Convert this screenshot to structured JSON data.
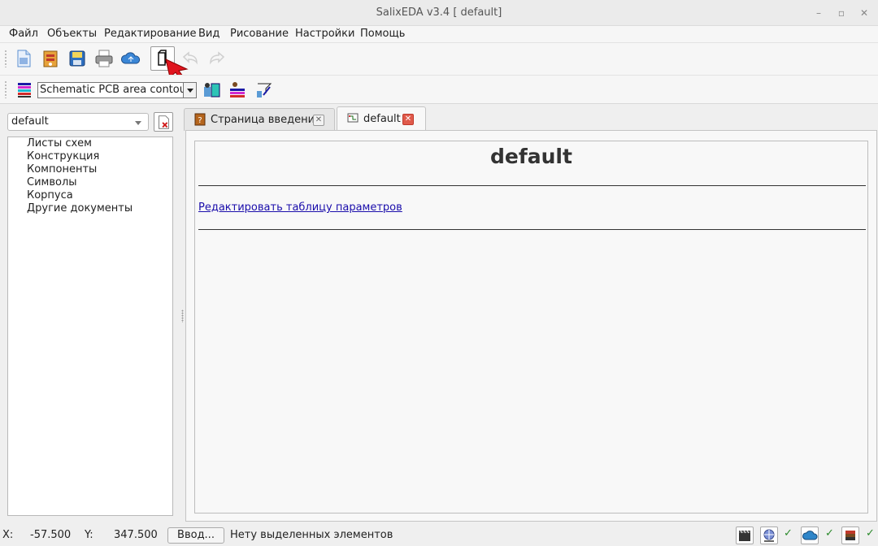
{
  "window": {
    "title": "SalixEDA v3.4 [ default]",
    "min": "–",
    "max": "▫",
    "close": "✕"
  },
  "menu": [
    "Файл",
    "Объекты",
    "Редактирование",
    "Вид",
    "Рисование",
    "Настройки",
    "Помощь"
  ],
  "toolbar": {
    "icons": [
      "new-file-icon",
      "open-project-icon",
      "save-icon",
      "print-icon",
      "cloud-icon",
      "new-sheet-icon",
      "undo-icon",
      "redo-icon"
    ],
    "layer_selected": "Schematic PCB area contour"
  },
  "left_panel": {
    "project": "default",
    "tree": [
      "Листы схем",
      "Конструкция",
      "Компоненты",
      "Символы",
      "Корпуса",
      "Другие документы"
    ]
  },
  "tabs": [
    {
      "label": "Страница введения",
      "active": false
    },
    {
      "label": "default",
      "active": true
    }
  ],
  "document": {
    "title": "default",
    "link": "Редактировать таблицу параметров"
  },
  "status": {
    "x_label": "X:",
    "x_value": "-57.500",
    "y_label": "Y:",
    "y_value": "347.500",
    "enter_button": "Ввод...",
    "message": "Нету выделенных элементов",
    "check": "✓"
  }
}
